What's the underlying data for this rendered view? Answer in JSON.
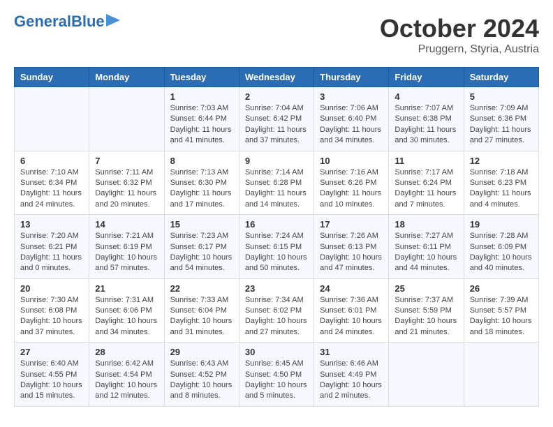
{
  "header": {
    "logo_line1": "General",
    "logo_line2": "Blue",
    "month": "October 2024",
    "location": "Pruggern, Styria, Austria"
  },
  "weekdays": [
    "Sunday",
    "Monday",
    "Tuesday",
    "Wednesday",
    "Thursday",
    "Friday",
    "Saturday"
  ],
  "weeks": [
    [
      {
        "day": "",
        "info": ""
      },
      {
        "day": "",
        "info": ""
      },
      {
        "day": "1",
        "info": "Sunrise: 7:03 AM\nSunset: 6:44 PM\nDaylight: 11 hours and 41 minutes."
      },
      {
        "day": "2",
        "info": "Sunrise: 7:04 AM\nSunset: 6:42 PM\nDaylight: 11 hours and 37 minutes."
      },
      {
        "day": "3",
        "info": "Sunrise: 7:06 AM\nSunset: 6:40 PM\nDaylight: 11 hours and 34 minutes."
      },
      {
        "day": "4",
        "info": "Sunrise: 7:07 AM\nSunset: 6:38 PM\nDaylight: 11 hours and 30 minutes."
      },
      {
        "day": "5",
        "info": "Sunrise: 7:09 AM\nSunset: 6:36 PM\nDaylight: 11 hours and 27 minutes."
      }
    ],
    [
      {
        "day": "6",
        "info": "Sunrise: 7:10 AM\nSunset: 6:34 PM\nDaylight: 11 hours and 24 minutes."
      },
      {
        "day": "7",
        "info": "Sunrise: 7:11 AM\nSunset: 6:32 PM\nDaylight: 11 hours and 20 minutes."
      },
      {
        "day": "8",
        "info": "Sunrise: 7:13 AM\nSunset: 6:30 PM\nDaylight: 11 hours and 17 minutes."
      },
      {
        "day": "9",
        "info": "Sunrise: 7:14 AM\nSunset: 6:28 PM\nDaylight: 11 hours and 14 minutes."
      },
      {
        "day": "10",
        "info": "Sunrise: 7:16 AM\nSunset: 6:26 PM\nDaylight: 11 hours and 10 minutes."
      },
      {
        "day": "11",
        "info": "Sunrise: 7:17 AM\nSunset: 6:24 PM\nDaylight: 11 hours and 7 minutes."
      },
      {
        "day": "12",
        "info": "Sunrise: 7:18 AM\nSunset: 6:23 PM\nDaylight: 11 hours and 4 minutes."
      }
    ],
    [
      {
        "day": "13",
        "info": "Sunrise: 7:20 AM\nSunset: 6:21 PM\nDaylight: 11 hours and 0 minutes."
      },
      {
        "day": "14",
        "info": "Sunrise: 7:21 AM\nSunset: 6:19 PM\nDaylight: 10 hours and 57 minutes."
      },
      {
        "day": "15",
        "info": "Sunrise: 7:23 AM\nSunset: 6:17 PM\nDaylight: 10 hours and 54 minutes."
      },
      {
        "day": "16",
        "info": "Sunrise: 7:24 AM\nSunset: 6:15 PM\nDaylight: 10 hours and 50 minutes."
      },
      {
        "day": "17",
        "info": "Sunrise: 7:26 AM\nSunset: 6:13 PM\nDaylight: 10 hours and 47 minutes."
      },
      {
        "day": "18",
        "info": "Sunrise: 7:27 AM\nSunset: 6:11 PM\nDaylight: 10 hours and 44 minutes."
      },
      {
        "day": "19",
        "info": "Sunrise: 7:28 AM\nSunset: 6:09 PM\nDaylight: 10 hours and 40 minutes."
      }
    ],
    [
      {
        "day": "20",
        "info": "Sunrise: 7:30 AM\nSunset: 6:08 PM\nDaylight: 10 hours and 37 minutes."
      },
      {
        "day": "21",
        "info": "Sunrise: 7:31 AM\nSunset: 6:06 PM\nDaylight: 10 hours and 34 minutes."
      },
      {
        "day": "22",
        "info": "Sunrise: 7:33 AM\nSunset: 6:04 PM\nDaylight: 10 hours and 31 minutes."
      },
      {
        "day": "23",
        "info": "Sunrise: 7:34 AM\nSunset: 6:02 PM\nDaylight: 10 hours and 27 minutes."
      },
      {
        "day": "24",
        "info": "Sunrise: 7:36 AM\nSunset: 6:01 PM\nDaylight: 10 hours and 24 minutes."
      },
      {
        "day": "25",
        "info": "Sunrise: 7:37 AM\nSunset: 5:59 PM\nDaylight: 10 hours and 21 minutes."
      },
      {
        "day": "26",
        "info": "Sunrise: 7:39 AM\nSunset: 5:57 PM\nDaylight: 10 hours and 18 minutes."
      }
    ],
    [
      {
        "day": "27",
        "info": "Sunrise: 6:40 AM\nSunset: 4:55 PM\nDaylight: 10 hours and 15 minutes."
      },
      {
        "day": "28",
        "info": "Sunrise: 6:42 AM\nSunset: 4:54 PM\nDaylight: 10 hours and 12 minutes."
      },
      {
        "day": "29",
        "info": "Sunrise: 6:43 AM\nSunset: 4:52 PM\nDaylight: 10 hours and 8 minutes."
      },
      {
        "day": "30",
        "info": "Sunrise: 6:45 AM\nSunset: 4:50 PM\nDaylight: 10 hours and 5 minutes."
      },
      {
        "day": "31",
        "info": "Sunrise: 6:46 AM\nSunset: 4:49 PM\nDaylight: 10 hours and 2 minutes."
      },
      {
        "day": "",
        "info": ""
      },
      {
        "day": "",
        "info": ""
      }
    ]
  ]
}
